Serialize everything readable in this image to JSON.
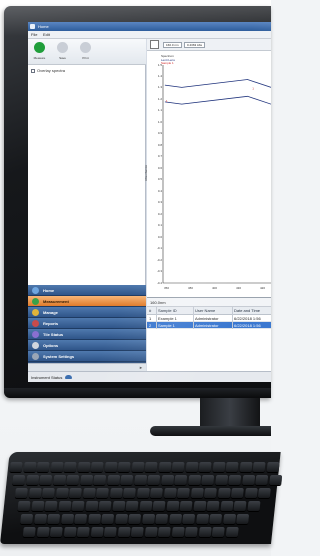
{
  "window": {
    "title": "Home",
    "menu": [
      "File",
      "Edit"
    ]
  },
  "toolbar": {
    "tools": [
      {
        "label": "Measure",
        "icon": "play-icon",
        "color": "#1f9e3a"
      },
      {
        "label": "Save",
        "icon": "save-icon",
        "color": "#c9ced6"
      },
      {
        "label": "Print",
        "icon": "print-icon",
        "color": "#c9ced6"
      }
    ]
  },
  "left_panel": {
    "overlay_label": "Overlay spectra"
  },
  "chart_toolbar": {
    "wavelength_pill": "160.0 nm",
    "absorbance_pill": "0.4363 Abs"
  },
  "chart_data": {
    "type": "line",
    "legend": [
      "Spectrum",
      "Lenti Lens",
      "Sample 1"
    ],
    "legend_colors": [
      "#333333",
      "#1b2f7a",
      "#d12a2a"
    ],
    "ylabel": "Absorbance",
    "yticks": [
      "1.5",
      "1.4",
      "1.3",
      "1.2",
      "1.1",
      "1.0",
      "0.9",
      "0.8",
      "0.7",
      "0.6",
      "0.5",
      "0.4",
      "0.3",
      "0.2",
      "0.1",
      "0.0",
      "-0.1",
      "-0.2",
      "-0.3",
      "-0.4"
    ],
    "xticks": [
      "350",
      "380",
      "400",
      "430",
      "420"
    ],
    "ylim": [
      -0.4,
      1.55
    ],
    "xlim": [
      330,
      445
    ],
    "series": [
      {
        "name": "Lenti Lens",
        "x": [
          332,
          350,
          420,
          445
        ],
        "y": [
          1.37,
          1.35,
          1.42,
          1.35
        ]
      },
      {
        "name": "Sample 1",
        "x": [
          332,
          350,
          420,
          445
        ],
        "y": [
          1.22,
          1.2,
          1.27,
          1.2
        ]
      }
    ],
    "marker_labels": [
      {
        "x": 333,
        "y": 1.22,
        "text": "1"
      },
      {
        "x": 425,
        "y": 1.33,
        "text": "1"
      }
    ]
  },
  "grid": {
    "caption": "160.0nm",
    "columns": [
      "#",
      "Sample ID",
      "User Name",
      "Date and Time"
    ],
    "rows": [
      [
        "1",
        "Example 1",
        "Administrator",
        "6/22/2018 1:56"
      ],
      [
        "2",
        "Sample 1",
        "Administrator",
        "6/22/2018 1:56"
      ]
    ],
    "selected_row": 1
  },
  "nav": {
    "items": [
      {
        "label": "Home",
        "color": "#6fa6e0",
        "icon": "home-icon"
      },
      {
        "label": "Measurement",
        "color": "#3aa14a",
        "icon": "measurement-icon"
      },
      {
        "label": "Manage",
        "color": "#e0b43a",
        "icon": "manage-icon"
      },
      {
        "label": "Reports",
        "color": "#c84b4b",
        "icon": "reports-icon"
      },
      {
        "label": "Tile Status",
        "color": "#8a6fd0",
        "icon": "tile-icon"
      },
      {
        "label": "Options",
        "color": "#d0d6de",
        "icon": "options-icon"
      },
      {
        "label": "System Settings",
        "color": "#9aa6b6",
        "icon": "settings-icon"
      }
    ],
    "active_index": 1
  },
  "status": {
    "label": "Instrument Status"
  }
}
